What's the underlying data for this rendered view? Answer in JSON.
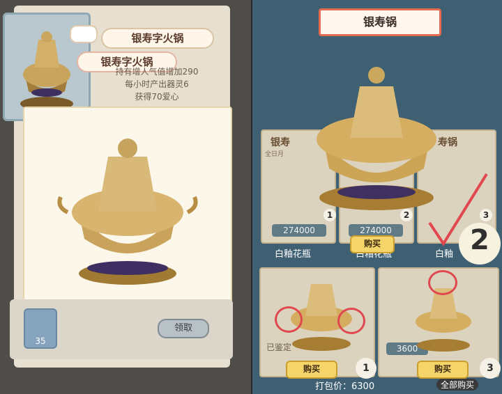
{
  "left_panel": {
    "item_name": "银寿字火锅",
    "popup_name": "银寿字火锅",
    "description": [
      "持有增人气值增加290",
      "每小时产出器灵6",
      "获得70爱心"
    ],
    "gem_count": "35",
    "claim_button": "领取"
  },
  "right_panel": {
    "title": "银寿锅",
    "cards": [
      {
        "title": "银寿",
        "price": "274000",
        "badge": "1",
        "label": "白釉花瓶",
        "tag": "全日月"
      },
      {
        "title": "",
        "price": "274000",
        "badge": "2",
        "label": "白釉花瓶",
        "tag": ""
      },
      {
        "title": "寿锅",
        "price": "",
        "badge": "3",
        "label": "白釉",
        "tag": ""
      }
    ],
    "buy_label": "购买",
    "bottom_buy_1": "购买",
    "bottom_buy_2": "购买",
    "bottom_price": "3600",
    "bottom_left_label": "已鉴定",
    "pack_price_label": "打包价：6300",
    "all_buy": "全部购买",
    "step_numbers": [
      "1",
      "2",
      "3"
    ],
    "big_step": "2"
  }
}
